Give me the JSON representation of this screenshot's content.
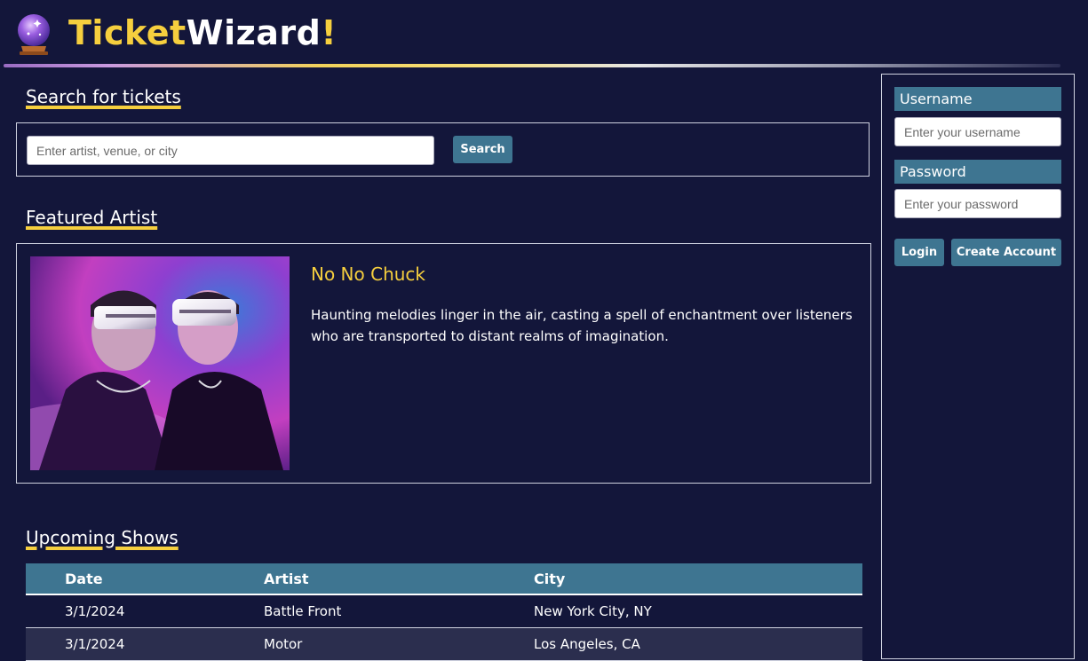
{
  "header": {
    "logo_part1": "Ticket",
    "logo_part2": "Wizard",
    "logo_part3": "!",
    "logo_icon": "crystal-ball-icon"
  },
  "search": {
    "title": "Search for tickets",
    "placeholder": "Enter artist, venue, or city",
    "button_label": "Search"
  },
  "featured": {
    "title": "Featured Artist",
    "artist_name": "No No Chuck",
    "description": "Haunting melodies linger in the air, casting a spell of enchantment over listeners who are transported to distant realms of imagination."
  },
  "shows": {
    "title": "Upcoming Shows",
    "columns": [
      "Date",
      "Artist",
      "City"
    ],
    "rows": [
      {
        "date": "3/1/2024",
        "artist": "Battle Front",
        "city": "New York City, NY"
      },
      {
        "date": "3/1/2024",
        "artist": "Motor",
        "city": "Los Angeles, CA"
      }
    ]
  },
  "login": {
    "username_label": "Username",
    "username_placeholder": "Enter your username",
    "password_label": "Password",
    "password_placeholder": "Enter your password",
    "login_label": "Login",
    "create_label": "Create Account"
  },
  "colors": {
    "background": "#13163a",
    "accent_yellow": "#f6cf3e",
    "button_blue": "#3e7591"
  }
}
